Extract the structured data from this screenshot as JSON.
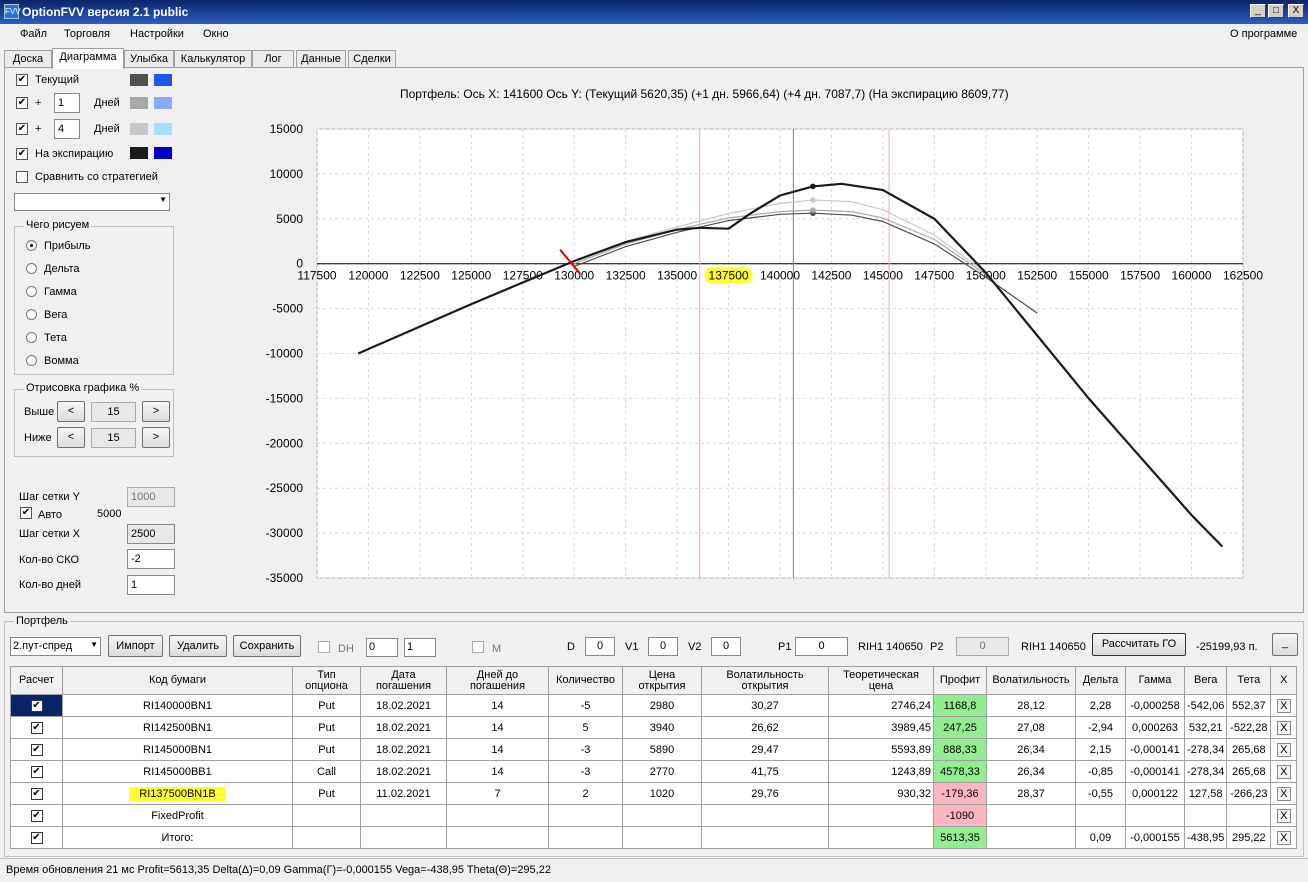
{
  "window": {
    "title": "OptionFVV версия 2.1 public",
    "minimize": "_",
    "maximize": "□",
    "close": "X"
  },
  "menu": {
    "file": "Файл",
    "trade": "Торговля",
    "settings": "Настройки",
    "window": "Окно",
    "about": "О программе"
  },
  "tabs": [
    "Доска",
    "Диаграмма",
    "Улыбка",
    "Калькулятор",
    "Лог",
    "Данные",
    "Сделки"
  ],
  "left": {
    "current": "Текущий",
    "plus": "+",
    "days_val1": "1",
    "days_val2": "4",
    "days": "Дней",
    "expiration": "На экспирацию",
    "compare": "Сравнить со стратегией",
    "what_title": "Чего рисуем",
    "radios": [
      "Прибыль",
      "Дельта",
      "Гамма",
      "Вега",
      "Тета",
      "Вомма"
    ],
    "draw_title": "Отрисовка графика %",
    "above": "Выше",
    "below": "Ниже",
    "above_val": "15",
    "below_val": "15",
    "prev": "<",
    "next": ">",
    "grid_y": "Шаг сетки Y",
    "grid_y_val": "1000",
    "auto": "Авто",
    "auto_val": "5000",
    "grid_x": "Шаг сетки X",
    "grid_x_val": "2500",
    "sko": "Кол-во СКО",
    "sko_val": "-2",
    "days_count": "Кол-во дней",
    "days_count_val": "1",
    "dropdown_arrow": "▼"
  },
  "colors": {
    "current1": "#505050",
    "current2": "#2255ee",
    "d1a": "#a8a8a8",
    "d1b": "#88aaff",
    "d4a": "#c8c8c8",
    "d4b": "#aaddff",
    "exp1": "#1a1a1a",
    "exp2": "#0000cc"
  },
  "chart_data": {
    "type": "line",
    "title": "Портфель: Ось X: 141600 Ось Y:  (Текущий 5620,35)  (+1 дн. 5966,64)  (+4 дн. 7087,7)  (На экспирацию 8609,77)",
    "xlim": [
      117500,
      162500
    ],
    "ylim": [
      -35000,
      15000
    ],
    "x_ticks": [
      117500,
      120000,
      122500,
      125000,
      127500,
      130000,
      132500,
      135000,
      137500,
      140000,
      142500,
      145000,
      147500,
      150000,
      152500,
      155000,
      157500,
      160000,
      162500
    ],
    "y_ticks": [
      15000,
      10000,
      5000,
      0,
      -5000,
      -10000,
      -15000,
      -20000,
      -25000,
      -30000,
      -35000
    ],
    "highlighted_tick": 137500,
    "vertical_lines": {
      "current_price": 140650,
      "sd_low": 136100,
      "sd_high": 145300
    },
    "series": [
      {
        "name": "На экспирацию",
        "color": "#1a1a1a",
        "x": [
          119500,
          125000,
          130000,
          132500,
          135000,
          136100,
          137500,
          138500,
          140000,
          141600,
          143000,
          145000,
          147500,
          150000,
          152500,
          155000,
          157500,
          160000,
          161500
        ],
        "y": [
          -10000,
          -4500,
          300,
          2400,
          3800,
          4000,
          3900,
          5500,
          7600,
          8610,
          8900,
          8200,
          5000,
          -1000,
          -8000,
          -15000,
          -21500,
          -28000,
          -31500
        ]
      },
      {
        "name": "+4 дн.",
        "color": "#c8c8c8",
        "x": [
          130000,
          132500,
          135000,
          137500,
          140000,
          141600,
          143500,
          145000,
          147500,
          150000
        ],
        "y": [
          300,
          2500,
          4100,
          5600,
          6700,
          7088,
          6900,
          6000,
          3200,
          -1000
        ]
      },
      {
        "name": "+1 дн.",
        "color": "#a8a8a8",
        "x": [
          130000,
          132500,
          135000,
          137500,
          140000,
          141600,
          143500,
          145000,
          147500,
          150000
        ],
        "y": [
          0,
          2200,
          3800,
          5100,
          5800,
          5967,
          5800,
          5100,
          2700,
          -1200
        ]
      },
      {
        "name": "Текущий",
        "color": "#505050",
        "x": [
          130000,
          132500,
          135000,
          137500,
          140000,
          141600,
          143500,
          145000,
          147500,
          150000,
          152500
        ],
        "y": [
          -300,
          1900,
          3500,
          4800,
          5500,
          5620,
          5400,
          4700,
          2200,
          -1500,
          -5500
        ]
      }
    ]
  },
  "portfolio": {
    "title": "Портфель",
    "strategy": "2.пут-спред",
    "import": "Импорт",
    "delete": "Удалить",
    "save": "Сохранить",
    "dh": "DH",
    "spin1": "0",
    "spin2": "1",
    "m": "M",
    "d": "D",
    "d_val": "0",
    "v1": "V1",
    "v1_val": "0",
    "v2": "V2",
    "v2_val": "0",
    "p1": "P1",
    "p1_val": "0",
    "rih1a": "RIH1 140650",
    "p2": "P2",
    "p2_val": "0",
    "rih1b": "RIH1 140650",
    "calc_go": "Рассчитать ГО",
    "go_val": "-25199,93 п.",
    "dash": "_"
  },
  "table": {
    "headers": [
      "Расчет",
      "Код бумаги",
      "Тип опциона",
      "Дата погашения",
      "Дней до погашения",
      "Количество",
      "Цена открытия",
      "Волатильность открытия",
      "Теоретическая цена",
      "Профит",
      "Волатильность",
      "Дельта",
      "Гамма",
      "Вега",
      "Тета",
      "X"
    ],
    "rows": [
      [
        "✔",
        "RI140000BN1",
        "Put",
        "18.02.2021",
        "14",
        "-5",
        "2980",
        "30,27",
        "2746,24",
        "1168,8",
        "28,12",
        "2,28",
        "-0,000258",
        "-542,06",
        "552,37",
        "X"
      ],
      [
        "✔",
        "RI142500BN1",
        "Put",
        "18.02.2021",
        "14",
        "5",
        "3940",
        "26,62",
        "3989,45",
        "247,25",
        "27,08",
        "-2,94",
        "0,000263",
        "532,21",
        "-522,28",
        "X"
      ],
      [
        "✔",
        "RI145000BN1",
        "Put",
        "18.02.2021",
        "14",
        "-3",
        "5890",
        "29,47",
        "5593,89",
        "888,33",
        "26,34",
        "2,15",
        "-0,000141",
        "-278,34",
        "265,68",
        "X"
      ],
      [
        "✔",
        "RI145000BB1",
        "Call",
        "18.02.2021",
        "14",
        "-3",
        "2770",
        "41,75",
        "1243,89",
        "4578,33",
        "26,34",
        "-0,85",
        "-0,000141",
        "-278,34",
        "265,68",
        "X"
      ],
      [
        "✔",
        "RI137500BN1B",
        "Put",
        "11.02.2021",
        "7",
        "2",
        "1020",
        "29,76",
        "930,32",
        "-179,36",
        "28,37",
        "-0,55",
        "0,000122",
        "127,58",
        "-266,23",
        "X"
      ],
      [
        "✔",
        "FixedProfit",
        "",
        "",
        "",
        "",
        "",
        "",
        "",
        "-1090",
        "",
        "",
        "",
        "",
        "",
        "X"
      ],
      [
        "✔",
        "Итого:",
        "",
        "",
        "",
        "",
        "",
        "",
        "",
        "5613,35",
        "",
        "0,09",
        "-0,000155",
        "-438,95",
        "295,22",
        "X"
      ]
    ]
  },
  "status": "Время обновления 21 мс  Profit=5613,35 Delta(Δ)=0,09 Gamma(Γ)=-0,000155 Vega=-438,95 Theta(Θ)=295,22"
}
